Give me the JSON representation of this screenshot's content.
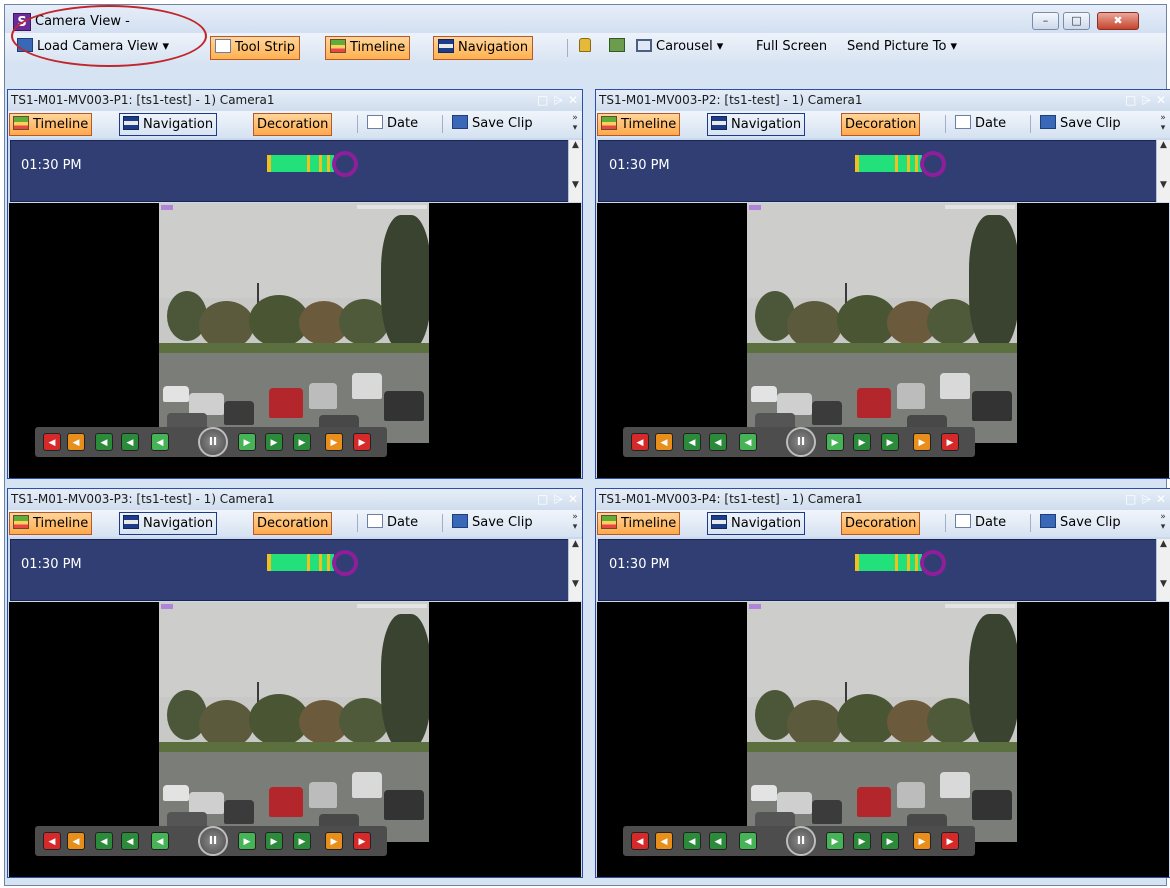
{
  "window": {
    "app_icon_letter": "S",
    "title": "Camera View -",
    "minimize": "–",
    "maximize": "□",
    "close": "✖"
  },
  "toolbar": {
    "load_camera_view": "Load Camera View ▾",
    "tool_strip": "Tool Strip",
    "timeline": "Timeline",
    "navigation": "Navigation",
    "carousel": "Carousel ▾",
    "full_screen": "Full Screen",
    "send_picture_to": "Send Picture To ▾"
  },
  "panel_tools": {
    "timeline": "Timeline",
    "navigation": "Navigation",
    "decoration": "Decoration",
    "date": "Date",
    "save_clip": "Save Clip"
  },
  "panels": [
    {
      "title": "TS1-M01-MV003-P1: [ts1-test] - 1) Camera1",
      "time": "01:30 PM"
    },
    {
      "title": "TS1-M01-MV003-P2: [ts1-test] - 1) Camera1",
      "time": "01:30 PM"
    },
    {
      "title": "TS1-M01-MV003-P3: [ts1-test] - 1) Camera1",
      "time": "01:30 PM"
    },
    {
      "title": "TS1-M01-MV003-P4: [ts1-test] - 1) Camera1",
      "time": "01:30 PM"
    }
  ],
  "colors": {
    "accent_orange": "#ffb14f",
    "timeline_bg": "#303e73",
    "timeline_segment": "#22e07a",
    "highlight_oval": "#c0262b",
    "playhead": "#8f1e9a"
  }
}
